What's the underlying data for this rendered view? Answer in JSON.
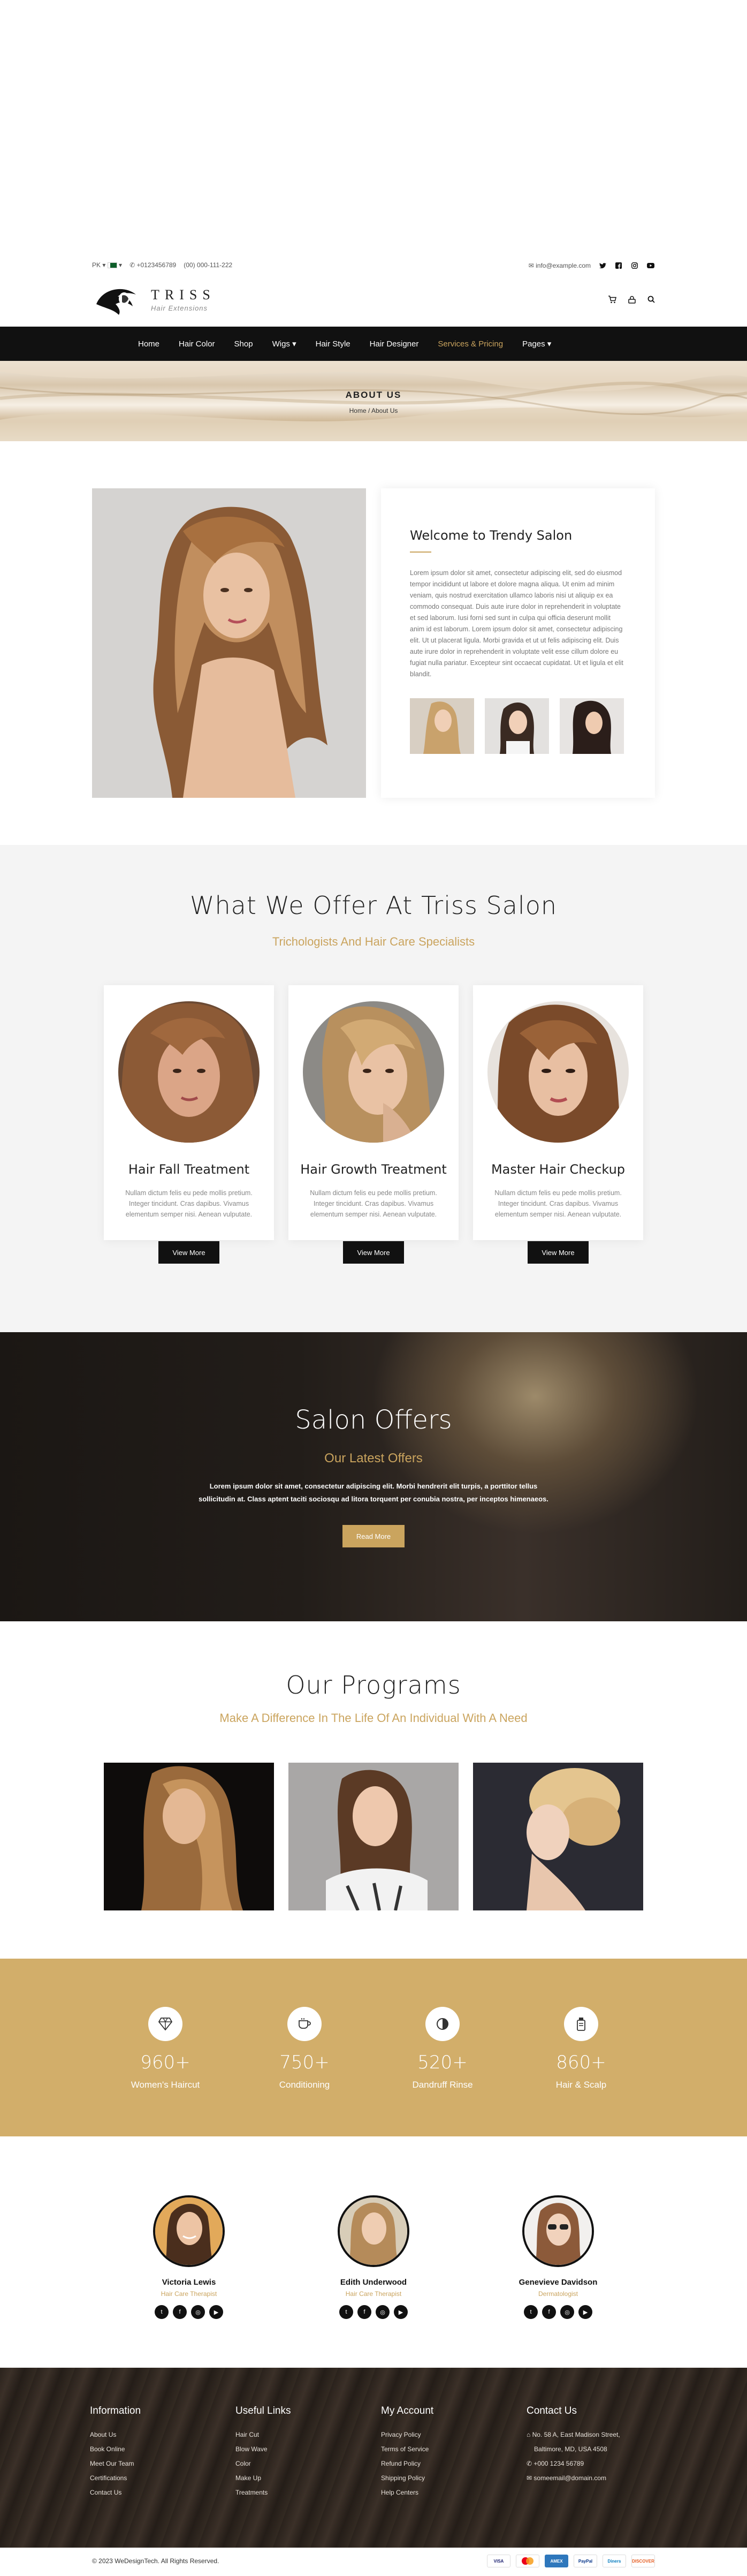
{
  "topbar": {
    "country": "PK",
    "phone1": "+0123456789",
    "phone2": "(00) 000-111-222",
    "email": "info@example.com"
  },
  "brand": {
    "name": "TRISS",
    "tagline": "Hair Extensions"
  },
  "nav": {
    "items": [
      "Home",
      "Hair Color",
      "Shop",
      "Wigs",
      "Hair Style",
      "Hair Designer",
      "Services & Pricing",
      "Pages"
    ],
    "active_index": 6
  },
  "banner": {
    "title": "ABOUT US",
    "crumb_home": "Home",
    "crumb_sep": "/",
    "crumb_current": "About Us"
  },
  "welcome": {
    "title": "Welcome to Trendy Salon",
    "body": "Lorem ipsum dolor sit amet, consectetur adipiscing elit, sed do eiusmod tempor incididunt ut labore et dolore magna aliqua. Ut enim ad minim veniam, quis nostrud exercitation ullamco laboris nisi ut aliquip ex ea commodo consequat. Duis aute irure dolor in reprehenderit in voluptate et sed laborum. Iusi forni sed sunt in culpa qui officia deserunt mollit anim id est laborum. Lorem ipsum dolor sit amet, consectetur adipiscing elit. Ut ut placerat ligula. Morbi gravida et ut ut felis adipiscing elit. Duis aute irure dolor in reprehenderit in voluptate velit esse cillum dolore eu fugiat nulla pariatur. Excepteur sint occaecat cupidatat. Ut et ligula et elit blandit."
  },
  "offer": {
    "title": "What We Offer At Triss Salon",
    "subtitle": "Trichologists And Hair Care Specialists",
    "cards": [
      {
        "title": "Hair Fall Treatment",
        "text": "Nullam dictum felis eu pede mollis pretium. Integer tincidunt. Cras dapibus. Vivamus elementum semper nisi. Aenean vulputate.",
        "button": "View More"
      },
      {
        "title": "Hair Growth Treatment",
        "text": "Nullam dictum felis eu pede mollis pretium. Integer tincidunt. Cras dapibus. Vivamus elementum semper nisi. Aenean vulputate.",
        "button": "View More"
      },
      {
        "title": "Master Hair Checkup",
        "text": "Nullam dictum felis eu pede mollis pretium. Integer tincidunt. Cras dapibus. Vivamus elementum semper nisi. Aenean vulputate.",
        "button": "View More"
      }
    ]
  },
  "salon": {
    "title": "Salon Offers",
    "subtitle": "Our Latest Offers",
    "text": "Lorem ipsum dolor sit amet, consectetur adipiscing elit. Morbi hendrerit elit turpis, a porttitor tellus sollicitudin at. Class aptent taciti sociosqu ad litora torquent per conubia nostra, per inceptos himenaeos.",
    "button": "Read More"
  },
  "programs": {
    "title": "Our Programs",
    "subtitle": "Make A Difference In The Life Of An Individual With A Need"
  },
  "stats": [
    {
      "icon": "diamond-icon",
      "value": "960+",
      "label": "Women's Haircut"
    },
    {
      "icon": "cup-icon",
      "value": "750+",
      "label": "Conditioning"
    },
    {
      "icon": "contrast-icon",
      "value": "520+",
      "label": "Dandruff Rinse"
    },
    {
      "icon": "bottle-icon",
      "value": "860+",
      "label": "Hair & Scalp"
    }
  ],
  "team": [
    {
      "name": "Victoria Lewis",
      "role": "Hair Care Therapist"
    },
    {
      "name": "Edith Underwood",
      "role": "Hair Care Therapist"
    },
    {
      "name": "Genevieve Davidson",
      "role": "Dermatologist"
    }
  ],
  "footer": {
    "info": {
      "title": "Information",
      "items": [
        "About Us",
        "Book Online",
        "Meet Our Team",
        "Certifications",
        "Contact Us"
      ]
    },
    "useful": {
      "title": "Useful Links",
      "items": [
        "Hair Cut",
        "Blow Wave",
        "Color",
        "Make Up",
        "Treatments"
      ]
    },
    "account": {
      "title": "My Account",
      "items": [
        "Privacy Policy",
        "Terms of Service",
        "Refund Policy",
        "Shipping Policy",
        "Help Centers"
      ]
    },
    "contact": {
      "title": "Contact Us",
      "address1": "No. 58 A, East Madison Street,",
      "address2": "Baltimore, MD, USA 4508",
      "phone": "+000 1234 56789",
      "email": "someemail@domain.com"
    }
  },
  "copyright": "© 2023 WeDesignTech. All Rights Reserved.",
  "payments": [
    "VISA",
    "MC",
    "AMEX",
    "PayPal",
    "Diners",
    "DISCOVER"
  ],
  "colors": {
    "accent": "#caa45e",
    "dark": "#111111",
    "stats_bg": "#d2ae6a"
  }
}
